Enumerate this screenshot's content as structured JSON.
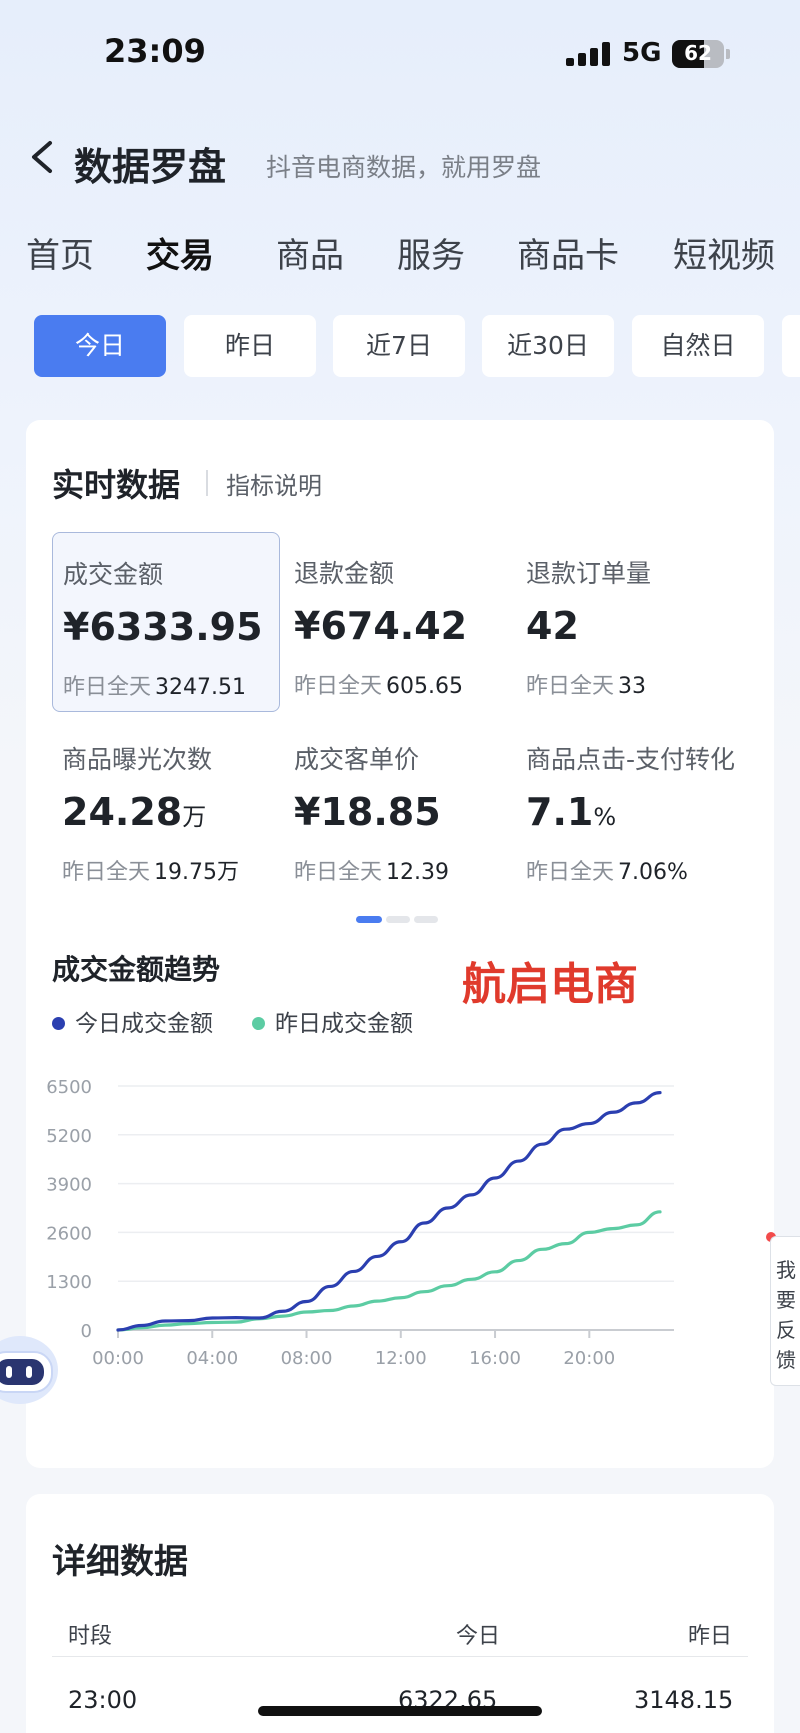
{
  "status_bar": {
    "time": "23:09",
    "network": "5G",
    "battery": "62"
  },
  "nav": {
    "title": "数据罗盘",
    "subtitle": "抖音电商数据，就用罗盘"
  },
  "tabs": [
    "首页",
    "交易",
    "商品",
    "服务",
    "商品卡",
    "短视频"
  ],
  "active_tab": "交易",
  "date_range": {
    "options": [
      "今日",
      "昨日",
      "近7日",
      "近30日",
      "自然日"
    ],
    "selected": "今日"
  },
  "realtime": {
    "title": "实时数据",
    "link": "指标说明",
    "metrics": [
      {
        "label": "成交金额",
        "value": "¥6333.95",
        "unit": "",
        "prev_label": "昨日全天",
        "prev_value": "3247.51",
        "selected": true
      },
      {
        "label": "退款金额",
        "value": "¥674.42",
        "unit": "",
        "prev_label": "昨日全天",
        "prev_value": "605.65",
        "selected": false
      },
      {
        "label": "退款订单量",
        "value": "42",
        "unit": "",
        "prev_label": "昨日全天",
        "prev_value": "33",
        "selected": false
      },
      {
        "label": "商品曝光次数",
        "value": "24.28",
        "unit": "万",
        "prev_label": "昨日全天",
        "prev_value": "19.75万",
        "selected": false
      },
      {
        "label": "成交客单价",
        "value": "¥18.85",
        "unit": "",
        "prev_label": "昨日全天",
        "prev_value": "12.39",
        "selected": false
      },
      {
        "label": "商品点击-支付转化",
        "value": "7.1",
        "unit": "%",
        "prev_label": "昨日全天",
        "prev_value": "7.06%",
        "selected": false
      }
    ],
    "page_indicator": {
      "pages": 3,
      "current": 1
    }
  },
  "trend": {
    "title": "成交金额趋势",
    "watermark": "航启电商",
    "colors": {
      "today": "#2b3fb0",
      "yesterday": "#5ccca3"
    }
  },
  "chart_data": {
    "type": "line",
    "x": [
      "00:00",
      "01:00",
      "02:00",
      "03:00",
      "04:00",
      "05:00",
      "06:00",
      "07:00",
      "08:00",
      "09:00",
      "10:00",
      "11:00",
      "12:00",
      "13:00",
      "14:00",
      "15:00",
      "16:00",
      "17:00",
      "18:00",
      "19:00",
      "20:00",
      "21:00",
      "22:00",
      "23:00"
    ],
    "series": [
      {
        "name": "今日成交金额",
        "values": [
          0,
          120,
          240,
          250,
          320,
          330,
          320,
          500,
          760,
          1160,
          1560,
          1960,
          2350,
          2850,
          3250,
          3600,
          4050,
          4500,
          4950,
          5350,
          5500,
          5800,
          6050,
          6322.65
        ]
      },
      {
        "name": "昨日成交金额",
        "values": [
          0,
          60,
          130,
          170,
          200,
          210,
          300,
          370,
          480,
          520,
          640,
          770,
          860,
          1020,
          1180,
          1350,
          1550,
          1850,
          2150,
          2300,
          2600,
          2700,
          2800,
          3148.15
        ]
      }
    ],
    "xticks": [
      "00:00",
      "04:00",
      "08:00",
      "12:00",
      "16:00",
      "20:00"
    ],
    "yticks": [
      0,
      1300,
      2600,
      3900,
      5200,
      6500
    ],
    "ylim": [
      0,
      6500
    ],
    "grid": true,
    "legend_position": "top-left"
  },
  "feedback": {
    "label": "我要反馈"
  },
  "detail": {
    "title": "详细数据",
    "columns": [
      "时段",
      "今日",
      "昨日"
    ],
    "rows": [
      {
        "period": "23:00",
        "today": "6322.65",
        "yesterday": "3148.15"
      }
    ]
  }
}
